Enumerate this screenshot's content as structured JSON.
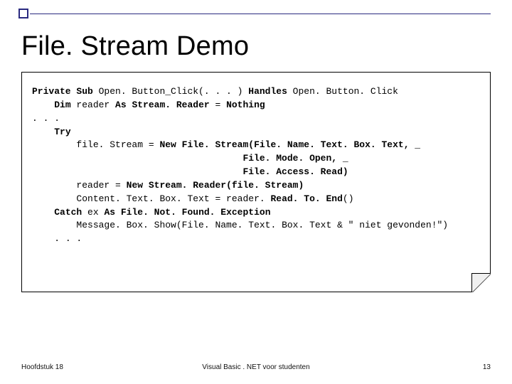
{
  "accent": {
    "color": "#2a2a80"
  },
  "title": "File. Stream Demo",
  "code": {
    "l1a": "Private Sub",
    "l1b": " Open. Button_Click(. . . ) ",
    "l1c": "Handles",
    "l1d": " Open. Button. Click",
    "l2a": "Dim",
    "l2b": " reader ",
    "l2c": "As ",
    "l2d": "Stream. Reader",
    "l2e": " = ",
    "l2f": "Nothing",
    "l3": ". . .",
    "l4": "Try",
    "l5a": "file. Stream = ",
    "l5b": "New File. Stream(File. Name. Text. Box. Text, _",
    "l6": "File. Mode. Open, _",
    "l7": "File. Access. Read)",
    "l8a": "reader = ",
    "l8b": "New Stream. Reader(file. Stream)",
    "l9a": "Content. Text. Box. Text = reader. ",
    "l9b": "Read. To. End",
    "l9c": "()",
    "l10a": "Catch",
    "l10b": " ex ",
    "l10c": "As ",
    "l10d": "File. Not. Found. Exception",
    "l11": "Message. Box. Show(File. Name. Text. Box. Text & \" niet gevonden!\")",
    "l12": ". . ."
  },
  "footer": {
    "left": "Hoofdstuk 18",
    "center": "Visual Basic . NET voor studenten",
    "right": "13"
  }
}
